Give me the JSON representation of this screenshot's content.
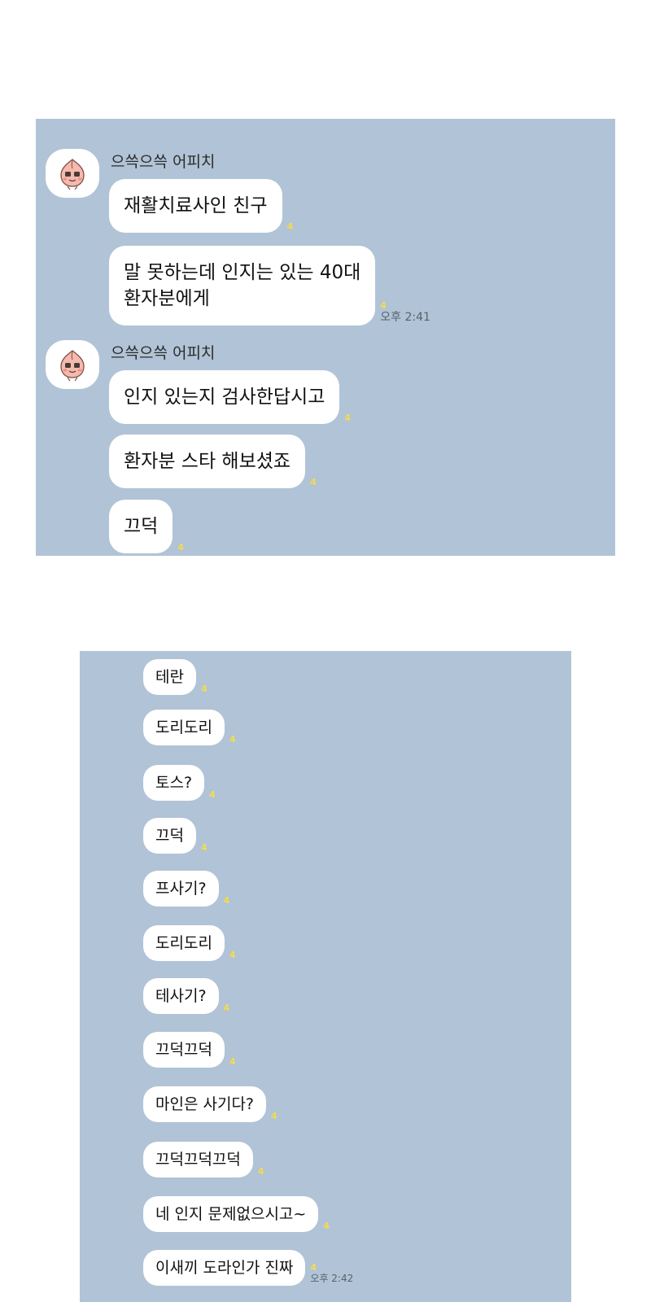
{
  "top_panel": {
    "groups": [
      {
        "sender": "으쓱으쓱 어피치",
        "messages": [
          {
            "text": "재활치료사인 친구",
            "unread": "4"
          },
          {
            "text": "말 못하는데 인지는 있는 40대\n환자분에게",
            "unread": "4",
            "time": "오후 2:41"
          }
        ]
      },
      {
        "sender": "으쓱으쓱 어피치",
        "messages": [
          {
            "text": "인지 있는지 검사한답시고",
            "unread": "4"
          },
          {
            "text": "환자분 스타 해보셨죠",
            "unread": "4"
          },
          {
            "text": "끄덕",
            "unread": "4"
          }
        ]
      }
    ]
  },
  "bottom_panel": {
    "messages": [
      {
        "text": "테란",
        "unread": "4"
      },
      {
        "text": "도리도리",
        "unread": "4"
      },
      {
        "text": "토스?",
        "unread": "4"
      },
      {
        "text": "끄덕",
        "unread": "4"
      },
      {
        "text": "프사기?",
        "unread": "4"
      },
      {
        "text": "도리도리",
        "unread": "4"
      },
      {
        "text": "테사기?",
        "unread": "4"
      },
      {
        "text": "끄덕끄덕",
        "unread": "4"
      },
      {
        "text": "마인은 사기다?",
        "unread": "4"
      },
      {
        "text": "끄덕끄덕끄덕",
        "unread": "4"
      },
      {
        "text": "네 인지 문제없으시고~",
        "unread": "4"
      },
      {
        "text": "이새끼 도라인가 진짜",
        "unread": "4",
        "time": "오후 2:42"
      }
    ]
  },
  "colors": {
    "chat_background": "#b1c3d6",
    "bubble": "#ffffff",
    "unread_count": "#f5dc4a",
    "timestamp": "#56636f"
  },
  "icons": {
    "avatar": "apeach-character-icon"
  }
}
